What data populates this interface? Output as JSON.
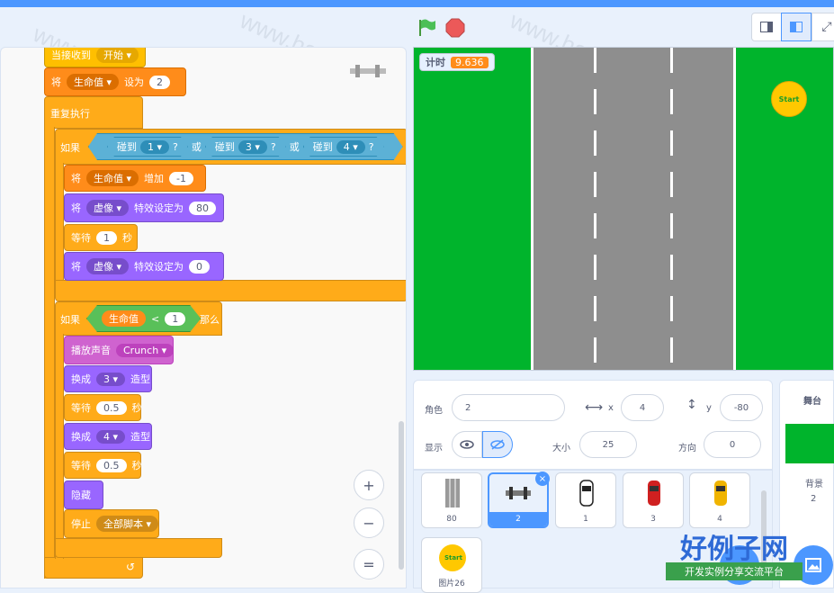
{
  "controls": {
    "green_flag": "green-flag",
    "stop": "stop-sign"
  },
  "blocks": {
    "hat_label": "当接收到",
    "hat_msg": "开始",
    "set1_a": "将",
    "set1_var": "生命值",
    "set1_b": "设为",
    "set1_val": "2",
    "forever": "重复执行",
    "if1": "如果",
    "touch_a": "碰到",
    "touch1": "1",
    "touch2": "3",
    "touch3": "4",
    "q": "?",
    "or": "或",
    "change_a": "将",
    "change_var": "生命值",
    "change_b": "增加",
    "change_val": "-1",
    "eff1_a": "将",
    "eff1_effect": "虚像",
    "eff1_b": "特效设定为",
    "eff1_val": "80",
    "wait1": "等待",
    "wait1_val": "1",
    "sec": "秒",
    "eff2_a": "将",
    "eff2_effect": "虚像",
    "eff2_b": "特效设定为",
    "eff2_val": "0",
    "if2": "如果",
    "cmp_var": "生命值",
    "cmp_op": "<",
    "cmp_val": "1",
    "then": "那么",
    "play_sound": "播放声音",
    "sound": "Crunch",
    "switch1_a": "换成",
    "switch1_val": "3",
    "costume": "造型",
    "wait2": "等待",
    "wait2_val": "0.5",
    "switch2_a": "换成",
    "switch2_val": "4",
    "wait3": "等待",
    "wait3_val": "0.5",
    "hide": "隐藏",
    "stop": "停止",
    "stop_opt": "全部脚本"
  },
  "zoom": {
    "in": "+",
    "out": "−",
    "reset": "="
  },
  "stage": {
    "timer_label": "计时",
    "timer_value": "9.636",
    "start_text": "Start"
  },
  "sprite_info": {
    "sprite_label": "角色",
    "sprite_name": "2",
    "x_label": "x",
    "x_value": "4",
    "y_label": "y",
    "y_value": "-80",
    "show_label": "显示",
    "size_label": "大小",
    "size_value": "25",
    "dir_label": "方向",
    "dir_value": "0"
  },
  "sprites": [
    {
      "name": "80"
    },
    {
      "name": "2"
    },
    {
      "name": "1"
    },
    {
      "name": "3"
    },
    {
      "name": "4"
    },
    {
      "name": "图片26"
    }
  ],
  "backdrop": {
    "title": "舞台",
    "label": "背景",
    "count": "2"
  },
  "watermark": "www.haolizi.com",
  "logo": {
    "title": "好例子网",
    "subtitle": "开发实例分享交流平台"
  }
}
